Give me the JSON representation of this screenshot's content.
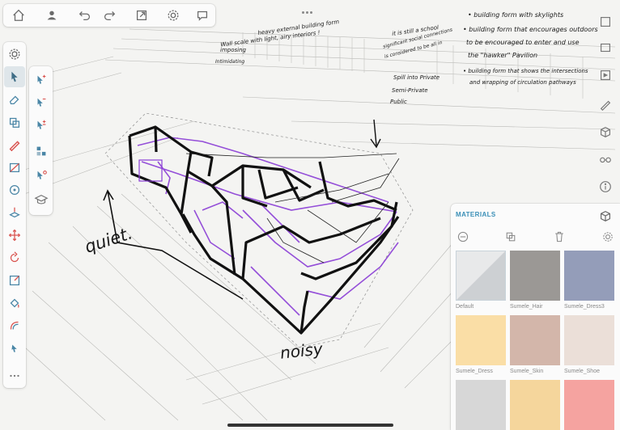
{
  "materials": {
    "title": "MATERIALS",
    "swatches": [
      {
        "label": "Default",
        "color": "#e8e9ea",
        "color2": "#cdd0d3"
      },
      {
        "label": "Sumele_Hair",
        "color": "#9b9895"
      },
      {
        "label": "Sumele_Dress3",
        "color": "#949db9"
      },
      {
        "label": "Sumele_Dress",
        "color": "#fadea6"
      },
      {
        "label": "Sumele_Skin",
        "color": "#d3b6aa"
      },
      {
        "label": "Sumele_Shoe",
        "color": "#ebdfd8"
      },
      {
        "label": "",
        "color": "#d7d7d7"
      },
      {
        "label": "",
        "color": "#f5d69c"
      },
      {
        "label": "",
        "color": "#f5a3a0"
      }
    ]
  },
  "annotations": {
    "top_center": [
      "heavy external building form",
      "Wall scale   with light, airy interiors !",
      "imposing",
      "Intimidating"
    ],
    "middle": [
      "it is still a school",
      "significant social connections",
      "is considered to be all in",
      "Spill into Private",
      "Semi-Private",
      "Public"
    ],
    "right": [
      "• building form with skylights",
      "• building form that encourages outdoors",
      "to be encouraged to enter and use",
      "the \"hawker\" Pavilion",
      "• building form that shows the intersections",
      "and wrapping of circulation pathways"
    ],
    "quiet": "quiet.",
    "noisy": "noisy"
  },
  "colors": {
    "accent": "#3a8fb7",
    "sketch_purple": "#8a3dd6",
    "ink": "#111111"
  }
}
